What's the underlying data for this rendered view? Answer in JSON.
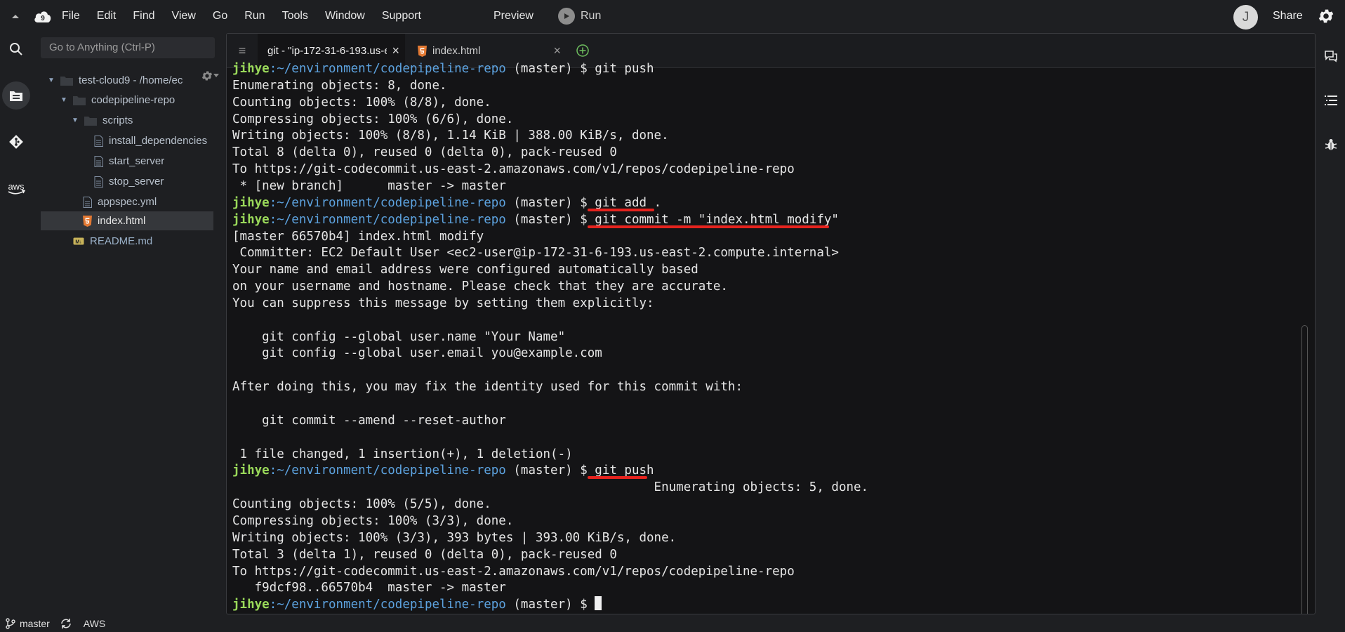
{
  "menubar": {
    "items": [
      "File",
      "Edit",
      "Find",
      "View",
      "Go",
      "Run",
      "Tools",
      "Window",
      "Support"
    ],
    "preview": "Preview",
    "run": "Run",
    "avatar_initial": "J",
    "share": "Share"
  },
  "sidebar": {
    "goto_placeholder": "Go to Anything (Ctrl-P)",
    "tree": [
      {
        "label": "test-cloud9 - /home/ec",
        "type": "folder",
        "expanded": true
      },
      {
        "label": "codepipeline-repo",
        "type": "folder",
        "expanded": true
      },
      {
        "label": "scripts",
        "type": "folder",
        "expanded": true
      },
      {
        "label": "install_dependencies",
        "type": "file"
      },
      {
        "label": "start_server",
        "type": "file"
      },
      {
        "label": "stop_server",
        "type": "file"
      },
      {
        "label": "appspec.yml",
        "type": "file"
      },
      {
        "label": "index.html",
        "type": "html",
        "selected": true
      },
      {
        "label": "README.md",
        "type": "md"
      }
    ]
  },
  "tabs": [
    {
      "label": "git - \"ip-172-31-6-193.us-e",
      "close": "×",
      "active": true
    },
    {
      "label": "index.html",
      "close": "×",
      "active": false
    }
  ],
  "terminal": {
    "prompt": {
      "user": "jihye",
      "path": ":~/environment/codepipeline-repo",
      "branch": " (master) $ "
    },
    "lines": [
      {
        "kind": "cmd",
        "cmd": "git push"
      },
      {
        "kind": "out",
        "text": "Enumerating objects: 8, done."
      },
      {
        "kind": "out",
        "text": "Counting objects: 100% (8/8), done."
      },
      {
        "kind": "out",
        "text": "Compressing objects: 100% (6/6), done."
      },
      {
        "kind": "out",
        "text": "Writing objects: 100% (8/8), 1.14 KiB | 388.00 KiB/s, done."
      },
      {
        "kind": "out",
        "text": "Total 8 (delta 0), reused 0 (delta 0), pack-reused 0"
      },
      {
        "kind": "out",
        "text": "To https://git-codecommit.us-east-2.amazonaws.com/v1/repos/codepipeline-repo"
      },
      {
        "kind": "out",
        "text": " * [new branch]      master -> master"
      },
      {
        "kind": "cmd",
        "cmd": "git add ."
      },
      {
        "kind": "cmd",
        "cmd": "git commit -m \"index.html modify\""
      },
      {
        "kind": "out",
        "text": "[master 66570b4] index.html modify"
      },
      {
        "kind": "out",
        "text": " Committer: EC2 Default User <ec2-user@ip-172-31-6-193.us-east-2.compute.internal>"
      },
      {
        "kind": "out",
        "text": "Your name and email address were configured automatically based"
      },
      {
        "kind": "out",
        "text": "on your username and hostname. Please check that they are accurate."
      },
      {
        "kind": "out",
        "text": "You can suppress this message by setting them explicitly:"
      },
      {
        "kind": "out",
        "text": ""
      },
      {
        "kind": "out",
        "text": "    git config --global user.name \"Your Name\""
      },
      {
        "kind": "out",
        "text": "    git config --global user.email you@example.com"
      },
      {
        "kind": "out",
        "text": ""
      },
      {
        "kind": "out",
        "text": "After doing this, you may fix the identity used for this commit with:"
      },
      {
        "kind": "out",
        "text": ""
      },
      {
        "kind": "out",
        "text": "    git commit --amend --reset-author"
      },
      {
        "kind": "out",
        "text": ""
      },
      {
        "kind": "out",
        "text": " 1 file changed, 1 insertion(+), 1 deletion(-)"
      },
      {
        "kind": "cmd",
        "cmd": "git push"
      },
      {
        "kind": "out",
        "text": "                                                         Enumerating objects: 5, done."
      },
      {
        "kind": "out",
        "text": "Counting objects: 100% (5/5), done."
      },
      {
        "kind": "out",
        "text": "Compressing objects: 100% (3/3), done."
      },
      {
        "kind": "out",
        "text": "Writing objects: 100% (3/3), 393 bytes | 393.00 KiB/s, done."
      },
      {
        "kind": "out",
        "text": "Total 3 (delta 1), reused 0 (delta 0), pack-reused 0"
      },
      {
        "kind": "out",
        "text": "To https://git-codecommit.us-east-2.amazonaws.com/v1/repos/codepipeline-repo"
      },
      {
        "kind": "out",
        "text": "   f9dcf98..66570b4  master -> master"
      },
      {
        "kind": "cmd",
        "cmd": ""
      }
    ]
  },
  "statusbar": {
    "branch": "master",
    "region": "AWS"
  },
  "colors": {
    "highlight": "#e5231e",
    "prompt_user": "#9ad95a",
    "prompt_path": "#5da3e0",
    "html_icon": "#e37933"
  }
}
